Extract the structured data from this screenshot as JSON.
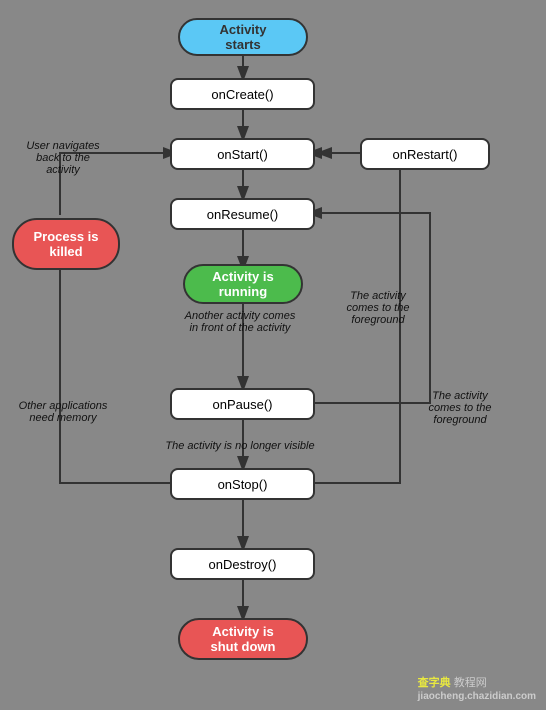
{
  "nodes": {
    "activity_starts": {
      "label": "Activity\nstarts"
    },
    "on_create": {
      "label": "onCreate()"
    },
    "on_start": {
      "label": "onStart()"
    },
    "on_restart": {
      "label": "onRestart()"
    },
    "on_resume": {
      "label": "onResume()"
    },
    "activity_running": {
      "label": "Activity is\nrunning"
    },
    "on_pause": {
      "label": "onPause()"
    },
    "on_stop": {
      "label": "onStop()"
    },
    "on_destroy": {
      "label": "onDestroy()"
    },
    "activity_shutdown": {
      "label": "Activity is\nshut down"
    },
    "process_killed": {
      "label": "Process is\nkilled"
    }
  },
  "labels": {
    "user_navigates": "User navigates\nback to the\nactivity",
    "another_activity": "Another activity comes\nin front of the activity",
    "activity_foreground1": "The activity\ncomes to the\nforeground",
    "activity_foreground2": "The activity\ncomes to the\nforeground",
    "no_longer_visible": "The activity is no longer visible",
    "other_apps": "Other applications\nneed memory"
  },
  "watermark": "查字典 教程网\njiaocheng.chazidian.com"
}
